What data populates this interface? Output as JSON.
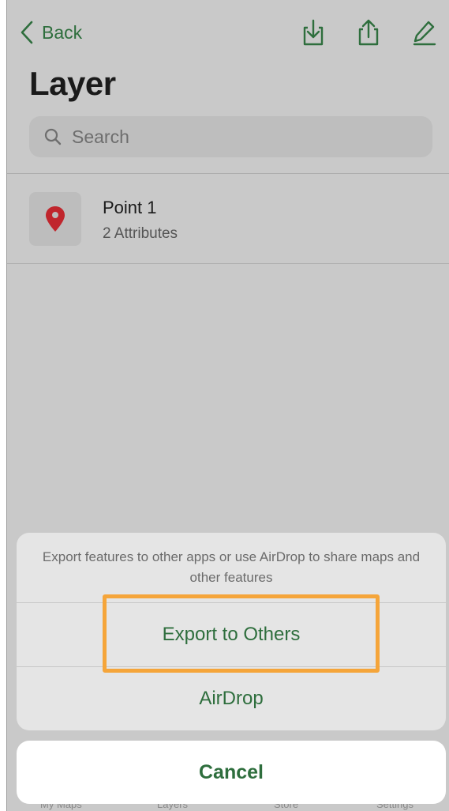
{
  "nav": {
    "back_label": "Back",
    "icons": [
      "import-icon",
      "share-icon",
      "edit-icon"
    ]
  },
  "page": {
    "title": "Layer"
  },
  "search": {
    "placeholder": "Search"
  },
  "layer_items": [
    {
      "title": "Point 1",
      "subtitle": "2 Attributes",
      "icon": "map-pin-icon"
    }
  ],
  "tab_bar": {
    "items": [
      "My Maps",
      "Layers",
      "Store",
      "Settings"
    ]
  },
  "action_sheet": {
    "message": "Export features to other apps or use AirDrop to share maps and other features",
    "actions": [
      "Export to Others",
      "AirDrop"
    ],
    "cancel_label": "Cancel",
    "highlighted_action": "Export to Others"
  },
  "colors": {
    "accent": "#2e6e3d",
    "pin": "#c0262d",
    "highlight": "#f5a53a",
    "overlay_bg": "#c9c9c9"
  }
}
